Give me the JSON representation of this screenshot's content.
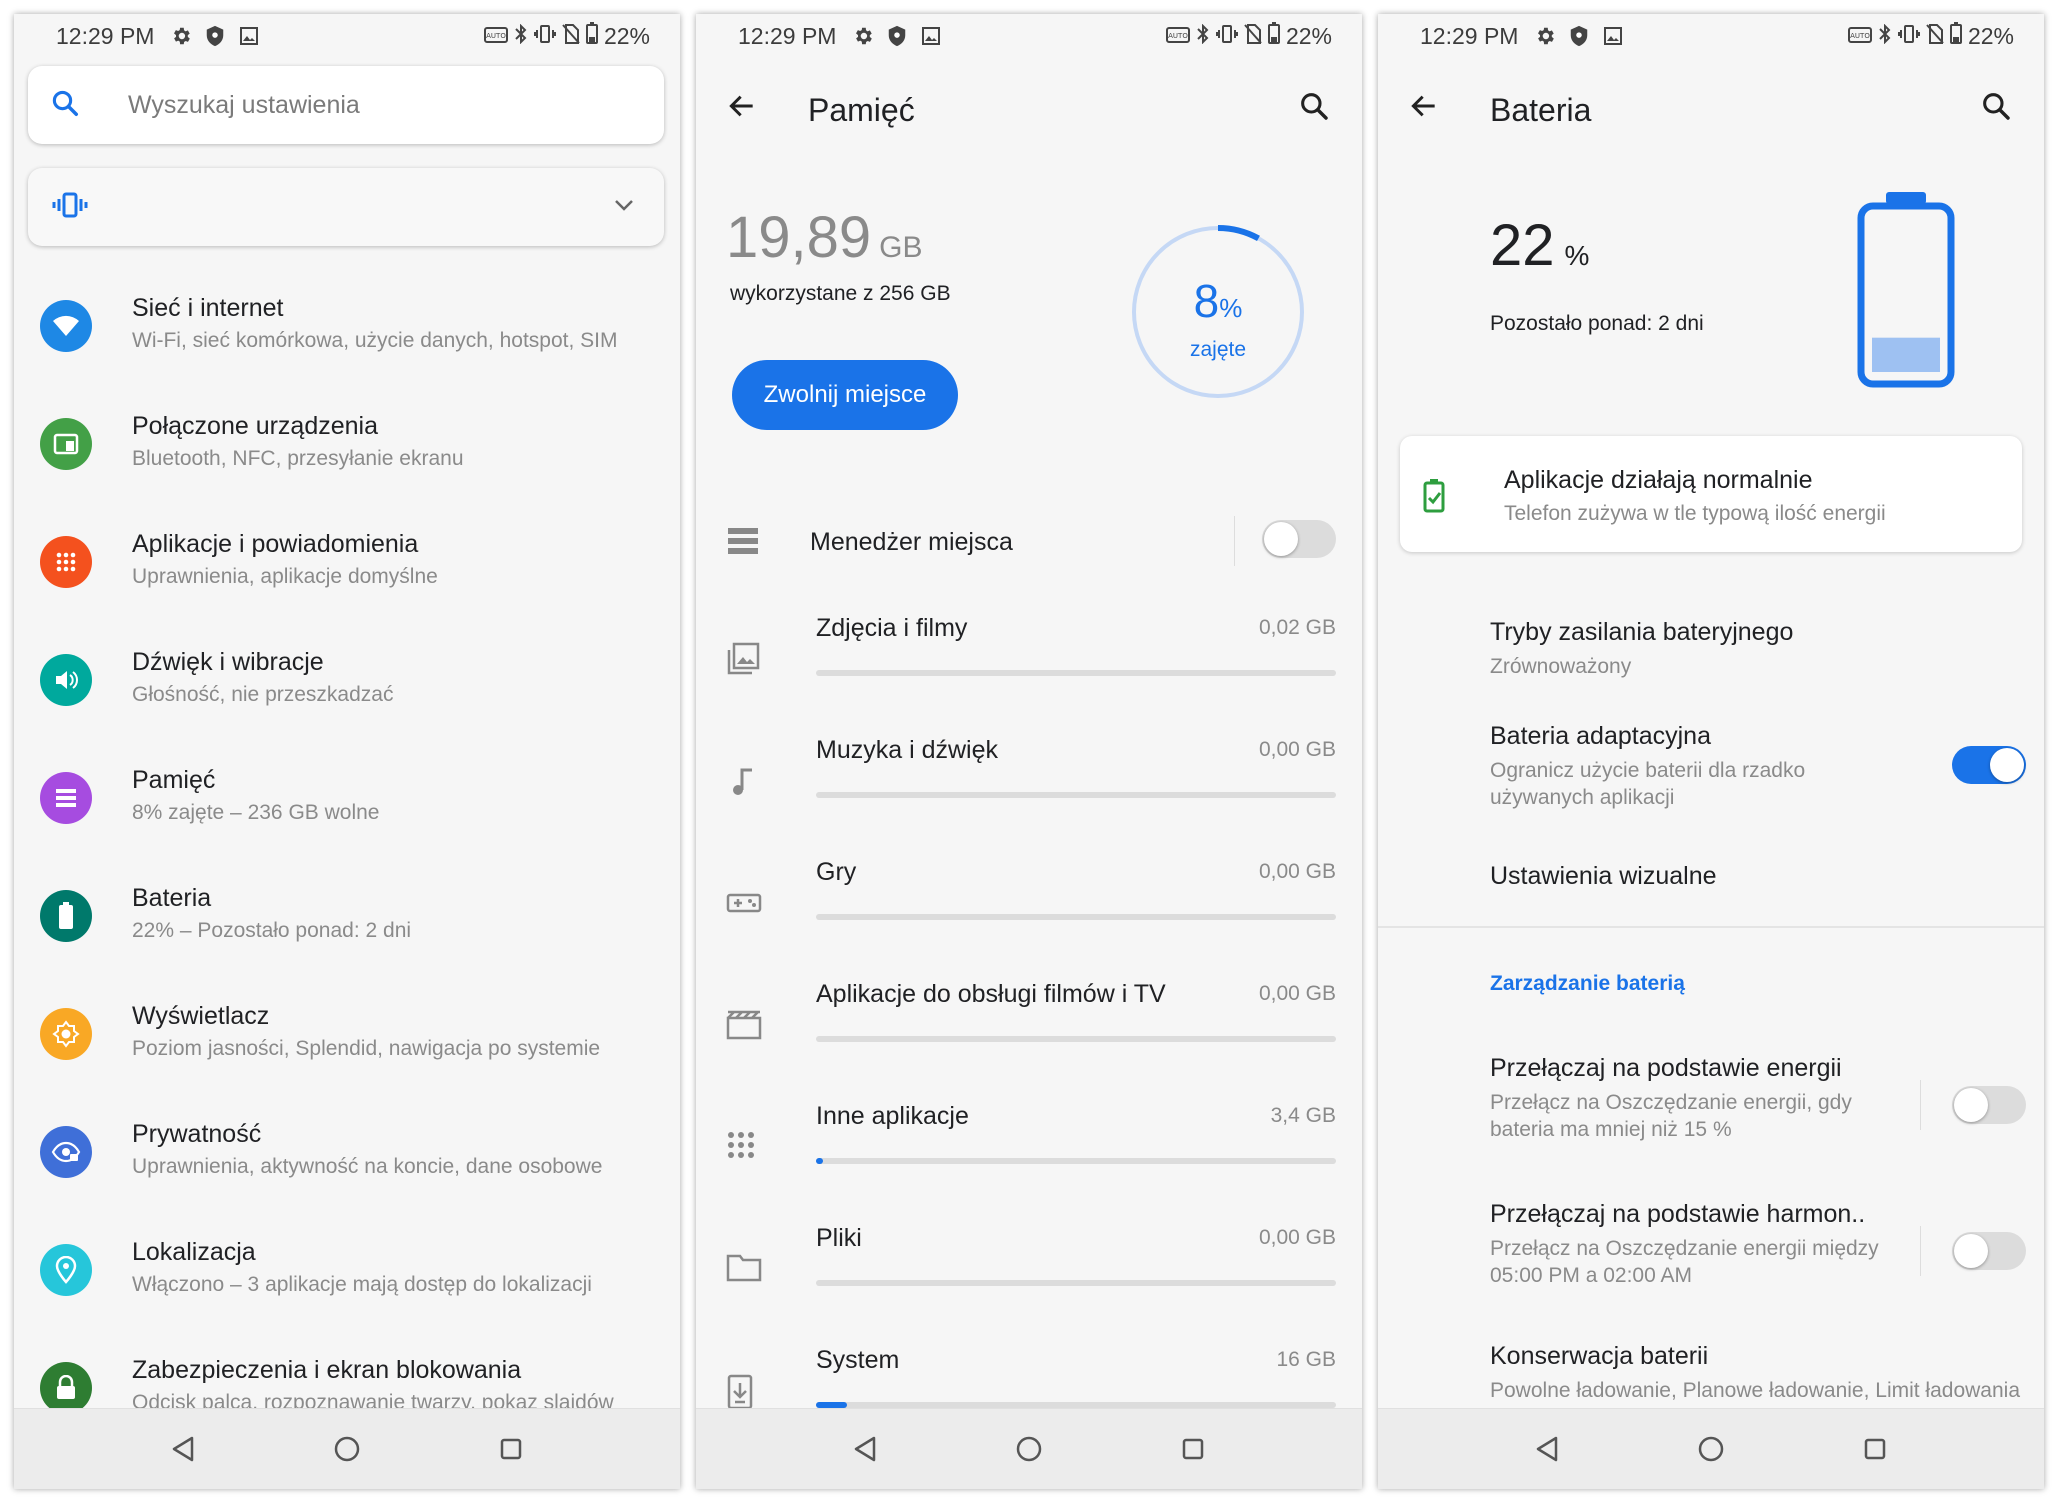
{
  "status": {
    "time": "12:29 PM",
    "battery": "22%"
  },
  "settings": {
    "search_placeholder": "Wyszukaj ustawienia",
    "items": [
      {
        "title": "Sieć i internet",
        "subtitle": "Wi-Fi, sieć komórkowa, użycie danych, hotspot, SIM",
        "color": "#1e88e5",
        "icon": "wifi-icon"
      },
      {
        "title": "Połączone urządzenia",
        "subtitle": "Bluetooth, NFC, przesyłanie ekranu",
        "color": "#43a047",
        "icon": "devices-icon"
      },
      {
        "title": "Aplikacje i powiadomienia",
        "subtitle": "Uprawnienia, aplikacje domyślne",
        "color": "#f4511e",
        "icon": "apps-icon"
      },
      {
        "title": "Dźwięk i wibracje",
        "subtitle": "Głośność, nie przeszkadzać",
        "color": "#00a99d",
        "icon": "volume-icon"
      },
      {
        "title": "Pamięć",
        "subtitle": "8% zajęte – 236 GB wolne",
        "color": "#a64ce0",
        "icon": "storage-icon"
      },
      {
        "title": "Bateria",
        "subtitle": "22% – Pozostało ponad: 2 dni",
        "color": "#00796b",
        "icon": "battery-icon"
      },
      {
        "title": "Wyświetlacz",
        "subtitle": "Poziom jasności, Splendid, nawigacja po systemie",
        "color": "#f9a825",
        "icon": "brightness-icon"
      },
      {
        "title": "Prywatność",
        "subtitle": "Uprawnienia, aktywność na koncie, dane osobowe",
        "color": "#3f6fd8",
        "icon": "privacy-icon"
      },
      {
        "title": "Lokalizacja",
        "subtitle": "Włączono – 3 aplikacje mają dostęp do lokalizacji",
        "color": "#26c6da",
        "icon": "location-icon"
      },
      {
        "title": "Zabezpieczenia i ekran blokowania",
        "subtitle": "Odcisk palca, rozpoznawanie twarzy, pokaz slajdów",
        "color": "#2e7d32",
        "icon": "lock-icon"
      }
    ]
  },
  "storage": {
    "title": "Pamięć",
    "used_value": "19,89",
    "used_unit": "GB",
    "used_desc": "wykorzystane z 256 GB",
    "free_button": "Zwolnij miejsce",
    "ring_percent": "8",
    "ring_percent_sign": "%",
    "ring_label": "zajęte",
    "ring_fraction": 0.08,
    "manager_label": "Menedżer miejsca",
    "manager_on": false,
    "categories": [
      {
        "label": "Zdjęcia i filmy",
        "value": "0,02 GB",
        "fraction": 0,
        "icon": "photos-icon"
      },
      {
        "label": "Muzyka i dźwięk",
        "value": "0,00 GB",
        "fraction": 0,
        "icon": "music-icon"
      },
      {
        "label": "Gry",
        "value": "0,00 GB",
        "fraction": 0,
        "icon": "games-icon"
      },
      {
        "label": "Aplikacje do obsługi filmów i TV",
        "value": "0,00 GB",
        "fraction": 0,
        "icon": "movies-icon"
      },
      {
        "label": "Inne aplikacje",
        "value": "3,4 GB",
        "fraction": 0.013,
        "icon": "other-apps-icon"
      },
      {
        "label": "Pliki",
        "value": "0,00 GB",
        "fraction": 0,
        "icon": "files-icon"
      },
      {
        "label": "System",
        "value": "16 GB",
        "fraction": 0.06,
        "icon": "system-icon"
      }
    ]
  },
  "battery": {
    "title": "Bateria",
    "percent": "22",
    "percent_sign": "%",
    "level": 0.22,
    "remaining": "Pozostało ponad: 2 dni",
    "status_title": "Aplikacje działają normalnie",
    "status_sub": "Telefon zużywa w tle typową ilość energii",
    "modes_title": "Tryby zasilania bateryjnego",
    "modes_sub": "Zrównoważony",
    "adaptive_title": "Bateria adaptacyjna",
    "adaptive_sub": "Ogranicz użycie baterii dla rzadko używanych aplikacji",
    "adaptive_on": true,
    "visual_title": "Ustawienia wizualne",
    "section_title": "Zarządzanie baterią",
    "switch_energy_title": "Przełączaj na podstawie energii",
    "switch_energy_sub": "Przełącz na Oszczędzanie energii, gdy bateria ma mniej niż 15 %",
    "switch_energy_on": false,
    "switch_schedule_title": "Przełączaj na podstawie harmon..",
    "switch_schedule_sub": "Przełącz na Oszczędzanie energii między 05:00 PM a 02:00 AM",
    "switch_schedule_on": false,
    "conserve_title": "Konserwacja baterii",
    "conserve_sub": "Powolne ładowanie, Planowe ładowanie, Limit ładowania"
  },
  "colors": {
    "accent": "#1a73e8"
  }
}
